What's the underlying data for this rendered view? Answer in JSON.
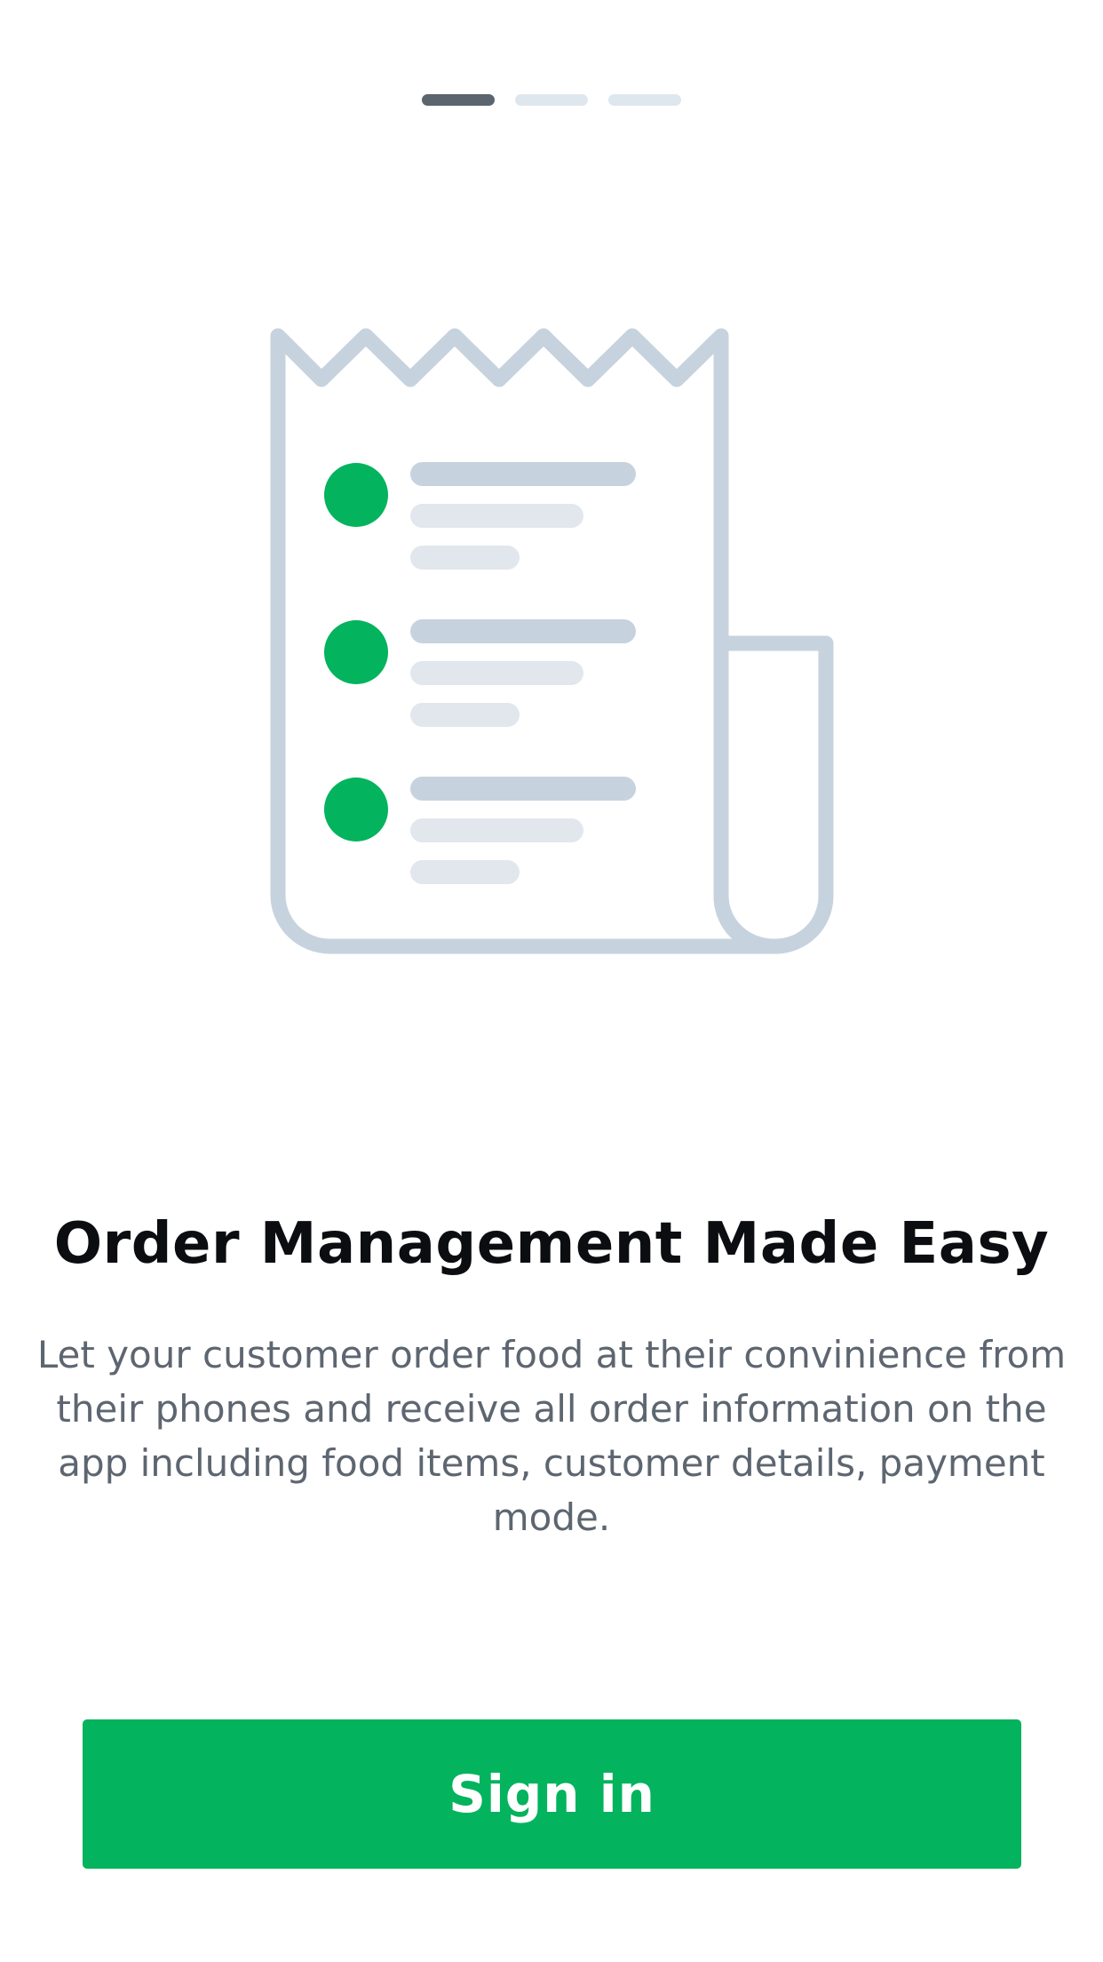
{
  "pager": {
    "total": 3,
    "active_index": 0
  },
  "illustration": {
    "icon": "receipt-icon",
    "accent_color": "#03b35d",
    "outline_color": "#c6d3de",
    "line_dark_color": "#c6d3de",
    "line_light_color": "#e1e7ec",
    "item_count": 3
  },
  "onboarding": {
    "title": "Order Management Made Easy",
    "description": "Let your customer order food at their  convinience from their phones and receive all order information on the app including food items, customer details, payment mode."
  },
  "actions": {
    "sign_in_label": "Sign in",
    "button_color": "#03b35d"
  }
}
